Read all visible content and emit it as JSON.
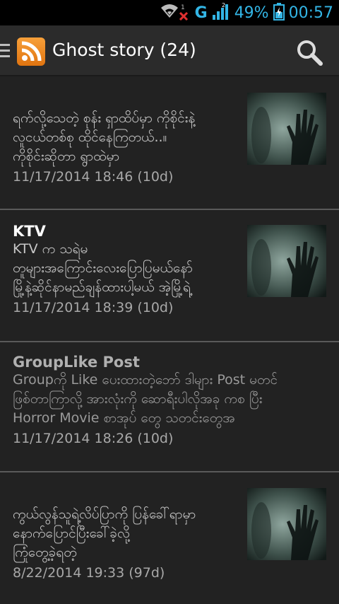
{
  "status_bar": {
    "network_label": "G",
    "battery_text": "49%",
    "time": "00:57",
    "accent_color": "#33b5e5",
    "icons": [
      "wifi-off-icon",
      "signal-icon",
      "battery-icon"
    ]
  },
  "action_bar": {
    "title": "Ghost story (24)",
    "app_icon": "rss-feed-icon",
    "search_icon": "search-icon",
    "menu_icon": "hamburger-icon"
  },
  "feed": {
    "items": [
      {
        "title": "",
        "description": "ရက်လို့သေတဲ့ စုန်း ရှာထိပ်မှာ ကိုစိုင်းနဲ့\nလူငယ်တစ်စု ထိုင်နေကြတယ်..။\nကိုစိုင်းဆိုတာ ရွာထဲမှာ",
        "date": "11/17/2014 18:46 (10d)",
        "has_thumbnail": true
      },
      {
        "title": "KTV",
        "description": "KTV က သရဲမ\nတူများအကြောင်းလေးပြောပြမယ်နော်\nမြို့နဲ့ဆိုင်နာမည်ချန်ထားပါ့မယ် အဲ့မြို့ရဲ့",
        "date": "11/17/2014 18:39 (10d)",
        "has_thumbnail": true
      },
      {
        "title": "GroupLike Post",
        "description": "Groupကို Like ပေးထားတဲ့ဘော် ဒါများ Post မတင်\nဖြစ်တာကြာလို့ အားလုံးကို ဆောရီးပါလိုအခု ကစ ပြီး\nHorror Movie စာအုပ် တွေ သတင်းတွေအ",
        "date": "11/17/2014 18:26 (10d)",
        "has_thumbnail": false
      },
      {
        "title": "",
        "description": "ကွယ်လွန်သူရဲ့လိပ်ပြာကို ပြန်ခေါ်ရာမှာ\nနောက်ပြောင်ပြီးခေါ်ခဲ့လို့\nကြုံတွေ့ခဲ့ရတဲ့",
        "date": "8/22/2014 19:33 (97d)",
        "has_thumbnail": true
      }
    ]
  }
}
